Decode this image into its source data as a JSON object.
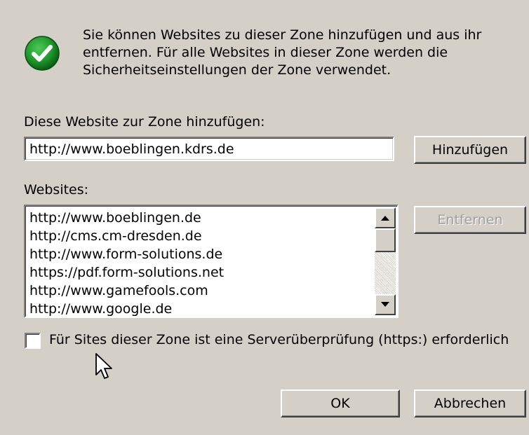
{
  "dialog": {
    "description": "Sie können Websites zu dieser Zone hinzufügen und aus ihr entfernen. Für alle Websites in dieser Zone werden die Sicherheitseinstellungen der Zone verwendet.",
    "add_label": "Diese Website zur Zone hinzufügen:",
    "url_value": "http://www.boeblingen.kdrs.de",
    "add_button": "Hinzufügen",
    "websites_label": "Websites:",
    "websites": [
      "http://www.boeblingen.de",
      "http://cms.cm-dresden.de",
      "http://www.form-solutions.de",
      "https://pdf.form-solutions.net",
      "http://www.gamefools.com",
      "http://www.google.de"
    ],
    "remove_button": "Entfernen",
    "https_checkbox_label": "Für Sites dieser Zone ist eine Serverüberprüfung (https:) erforderlich",
    "https_checked": false,
    "ok_button": "OK",
    "cancel_button": "Abbrechen",
    "icon": "checkmark-icon",
    "colors": {
      "background": "#d4d0c8",
      "icon_green": "#1e9a2a",
      "disabled_text": "#a0a0a0"
    }
  }
}
